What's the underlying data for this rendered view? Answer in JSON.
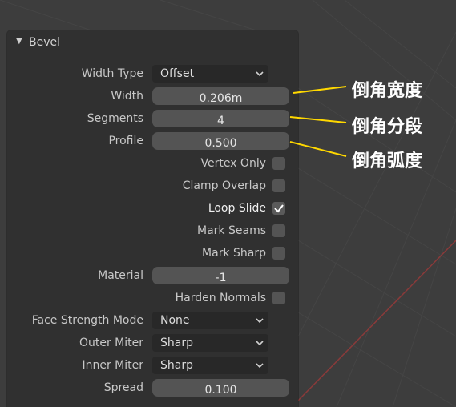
{
  "panel": {
    "title": "Bevel",
    "rows": {
      "width_type": {
        "label": "Width Type",
        "value": "Offset"
      },
      "width": {
        "label": "Width",
        "value": "0.206m"
      },
      "segments": {
        "label": "Segments",
        "value": "4"
      },
      "profile": {
        "label": "Profile",
        "value": "0.500"
      },
      "vertex_only": {
        "label": "Vertex Only",
        "checked": false
      },
      "clamp_overlap": {
        "label": "Clamp Overlap",
        "checked": false
      },
      "loop_slide": {
        "label": "Loop Slide",
        "checked": true
      },
      "mark_seams": {
        "label": "Mark Seams",
        "checked": false
      },
      "mark_sharp": {
        "label": "Mark Sharp",
        "checked": false
      },
      "material": {
        "label": "Material",
        "value": "-1"
      },
      "harden_normals": {
        "label": "Harden Normals",
        "checked": false
      },
      "face_strength_mode": {
        "label": "Face Strength Mode",
        "value": "None"
      },
      "outer_miter": {
        "label": "Outer Miter",
        "value": "Sharp"
      },
      "inner_miter": {
        "label": "Inner Miter",
        "value": "Sharp"
      },
      "spread": {
        "label": "Spread",
        "value": "0.100"
      }
    }
  },
  "annotations": {
    "width": "倒角宽度",
    "segments": "倒角分段",
    "profile": "倒角弧度"
  },
  "colors": {
    "viewport_bg": "#3d3d3d",
    "panel_bg": "#303030",
    "field_bg": "#545454",
    "dropdown_bg": "#282828",
    "annotation_line": "#ffd800",
    "axis_red": "#8a3a3a"
  }
}
